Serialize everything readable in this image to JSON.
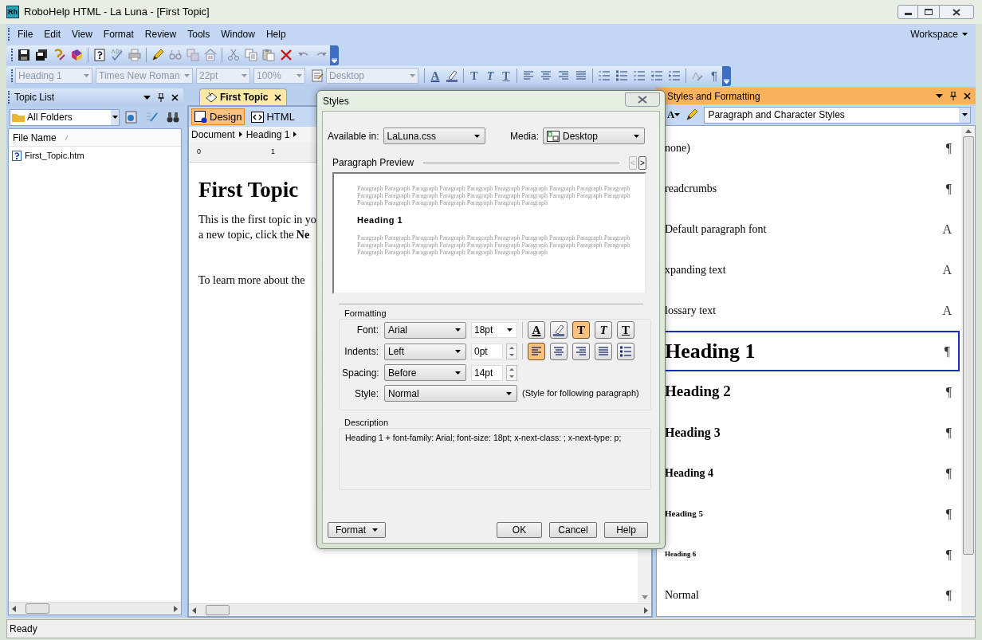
{
  "window": {
    "app_icon": "Rh",
    "title": "RoboHelp HTML - La Luna - [First Topic]"
  },
  "menu": [
    "File",
    "Edit",
    "View",
    "Format",
    "Review",
    "Tools",
    "Window",
    "Help"
  ],
  "workspace": "Workspace",
  "format_toolbar": {
    "dropdowns": [
      {
        "value": "Heading 1",
        "disabled": true
      },
      {
        "value": "Times New Roman",
        "disabled": true
      },
      {
        "value": "22pt",
        "disabled": true
      },
      {
        "value": "100%",
        "disabled": true
      },
      {
        "value": "Desktop",
        "disabled": true
      }
    ],
    "glyph_buttons": [
      {
        "kind": "font_color",
        "glyph": "A"
      },
      {
        "kind": "bold",
        "glyph": "T"
      },
      {
        "kind": "italic",
        "glyph": "T"
      },
      {
        "kind": "underline",
        "glyph": "T"
      },
      {
        "kind": "pilcrow",
        "glyph": "¶"
      }
    ]
  },
  "topic_list": {
    "title": "Topic List",
    "folder": "All Folders",
    "column": "File Name",
    "files": [
      "First_Topic.htm"
    ]
  },
  "editor": {
    "tabs": [
      {
        "label": "First Topic",
        "selected": true
      }
    ],
    "views": [
      {
        "label": "Design",
        "selected": true
      },
      {
        "label": "HTML",
        "selected": false
      }
    ],
    "breadcrumb": [
      "Document",
      "Heading 1"
    ],
    "ruler": [
      "0",
      "1"
    ],
    "heading": "First Topic",
    "paragraphs": [
      [
        "This is the first topic in yo",
        "a new topic, click the **Ne**"
      ],
      [
        "To learn more about the"
      ]
    ]
  },
  "styles_panel": {
    "title": "Styles and Formatting",
    "style_button": "A",
    "filter": "Paragraph and Character Styles",
    "styles": [
      {
        "name": "none)",
        "kind": "paragraph",
        "mark": "¶",
        "selected": false
      },
      {
        "name": "readcrumbs",
        "kind": "paragraph",
        "mark": "¶",
        "selected": false
      },
      {
        "name": "Default paragraph font",
        "kind": "character",
        "mark": "A",
        "selected": false
      },
      {
        "name": "xpanding text",
        "kind": "character",
        "mark": "A",
        "selected": false
      },
      {
        "name": "lossary text",
        "kind": "character",
        "mark": "A",
        "selected": false
      },
      {
        "name": "Heading 1",
        "kind": "heading1",
        "mark": "¶",
        "selected": true
      },
      {
        "name": "Heading 2",
        "kind": "heading2",
        "mark": "¶",
        "selected": false
      },
      {
        "name": "Heading 3",
        "kind": "heading3",
        "mark": "¶",
        "selected": false
      },
      {
        "name": "Heading 4",
        "kind": "heading4",
        "mark": "¶",
        "selected": false
      },
      {
        "name": "Heading 5",
        "kind": "heading5",
        "mark": "¶",
        "selected": false
      },
      {
        "name": "Heading 6",
        "kind": "heading6",
        "mark": "¶",
        "selected": false
      },
      {
        "name": "Normal",
        "kind": "paragraph",
        "mark": "¶",
        "selected": false
      }
    ]
  },
  "dialog": {
    "title": "Styles",
    "available_label": "Available in:",
    "available": "LaLuna.css",
    "media_label": "Media:",
    "media": "Desktop",
    "preview_label": "Paragraph Preview",
    "preview_prev": "<",
    "preview_next": ">",
    "preview_before": "Paragraph Paragraph Paragraph Paragraph Paragraph Paragraph Paragraph Paragraph Paragraph Paragraph Paragraph Paragraph Paragraph Paragraph Paragraph Paragraph Paragraph Paragraph Paragraph Paragraph Paragraph Paragraph Paragraph Paragraph Paragraph Paragraph Paragraph",
    "preview_heading": "Heading 1",
    "preview_after": "Paragraph Paragraph Paragraph Paragraph Paragraph Paragraph Paragraph Paragraph Paragraph Paragraph Paragraph Paragraph Paragraph Paragraph Paragraph Paragraph Paragraph Paragraph Paragraph Paragraph Paragraph Paragraph Paragraph Paragraph Paragraph Paragraph Paragraph",
    "formatting_label": "Formatting",
    "font_label": "Font:",
    "font": "Arial",
    "size": "18pt",
    "indents_label": "Indents:",
    "indents": "Left",
    "indent_value": "0pt",
    "spacing_label": "Spacing:",
    "spacing": "Before",
    "spacing_value": "14pt",
    "style_label": "Style:",
    "next_style": "Normal",
    "next_style_note": "(Style for following paragraph)",
    "char_buttons": [
      {
        "kind": "font_color",
        "glyph": "A",
        "selected": false
      },
      {
        "kind": "highlight",
        "selected": false
      },
      {
        "kind": "bold",
        "glyph": "T",
        "selected": true
      },
      {
        "kind": "italic",
        "glyph": "T",
        "selected": false
      },
      {
        "kind": "underline",
        "glyph": "T",
        "selected": false
      }
    ],
    "align_buttons": [
      {
        "kind": "left",
        "selected": true
      },
      {
        "kind": "center",
        "selected": false
      },
      {
        "kind": "right",
        "selected": false
      },
      {
        "kind": "justify",
        "selected": false
      },
      {
        "kind": "bullets",
        "selected": false
      }
    ],
    "description_label": "Description",
    "description": "Heading 1 + font-family: Arial;  font-size: 18pt;  x-next-class: ;  x-next-type: p;",
    "buttons": [
      "Format",
      "OK",
      "Cancel",
      "Help"
    ]
  },
  "status_bar": "Ready"
}
